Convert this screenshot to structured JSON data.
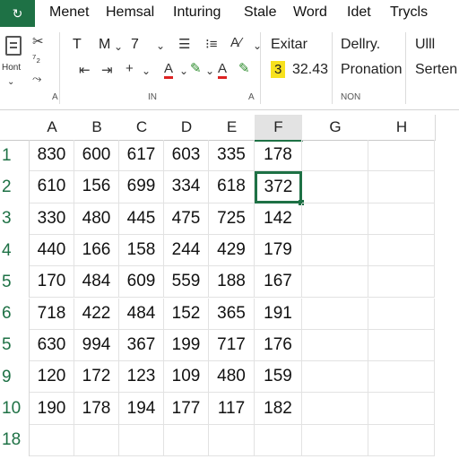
{
  "app": {
    "icon_glyph": "↻"
  },
  "menu": [
    "Menet",
    "Hemsal",
    "Inturing",
    "Stale",
    "Word",
    "Idet",
    "Trycls"
  ],
  "ribbon": {
    "clipboard": {
      "cut_glyph": "✂",
      "label": "Hont",
      "group": "A"
    },
    "font": {
      "t": "T",
      "m": "M",
      "size": "7",
      "group": "IN"
    },
    "styles": {
      "label": "Exitar",
      "value_badge": "3",
      "value": "32.43",
      "group": "A"
    },
    "right": {
      "label1": "Dellry.",
      "label2": "Pronation",
      "label3": "Ulll",
      "label4": "Serten",
      "group": "NON"
    }
  },
  "grid": {
    "columns": [
      "A",
      "B",
      "C",
      "D",
      "E",
      "F",
      "G",
      "H"
    ],
    "selected_column": "F",
    "rows": [
      {
        "label": "1",
        "values": [
          "830",
          "600",
          "617",
          "603",
          "335",
          "178"
        ]
      },
      {
        "label": "2",
        "values": [
          "610",
          "156",
          "699",
          "334",
          "618",
          "372"
        ]
      },
      {
        "label": "3",
        "values": [
          "330",
          "480",
          "445",
          "475",
          "725",
          "142"
        ]
      },
      {
        "label": "4",
        "values": [
          "440",
          "166",
          "158",
          "244",
          "429",
          "179"
        ]
      },
      {
        "label": "5",
        "values": [
          "170",
          "484",
          "609",
          "559",
          "188",
          "167"
        ]
      },
      {
        "label": "6",
        "values": [
          "718",
          "422",
          "484",
          "152",
          "365",
          "191"
        ]
      },
      {
        "label": "5",
        "values": [
          "630",
          "994",
          "367",
          "199",
          "717",
          "176"
        ]
      },
      {
        "label": "9",
        "values": [
          "120",
          "172",
          "123",
          "109",
          "480",
          "159"
        ]
      },
      {
        "label": "10",
        "values": [
          "190",
          "178",
          "194",
          "177",
          "117",
          "182"
        ]
      },
      {
        "label": "18",
        "values": [
          "",
          "",
          "",
          "",
          "",
          ""
        ]
      }
    ],
    "selected_cell": {
      "row": 1,
      "col": 5
    }
  },
  "colors": {
    "accent": "#1e7145",
    "badge": "#f7e11e"
  }
}
